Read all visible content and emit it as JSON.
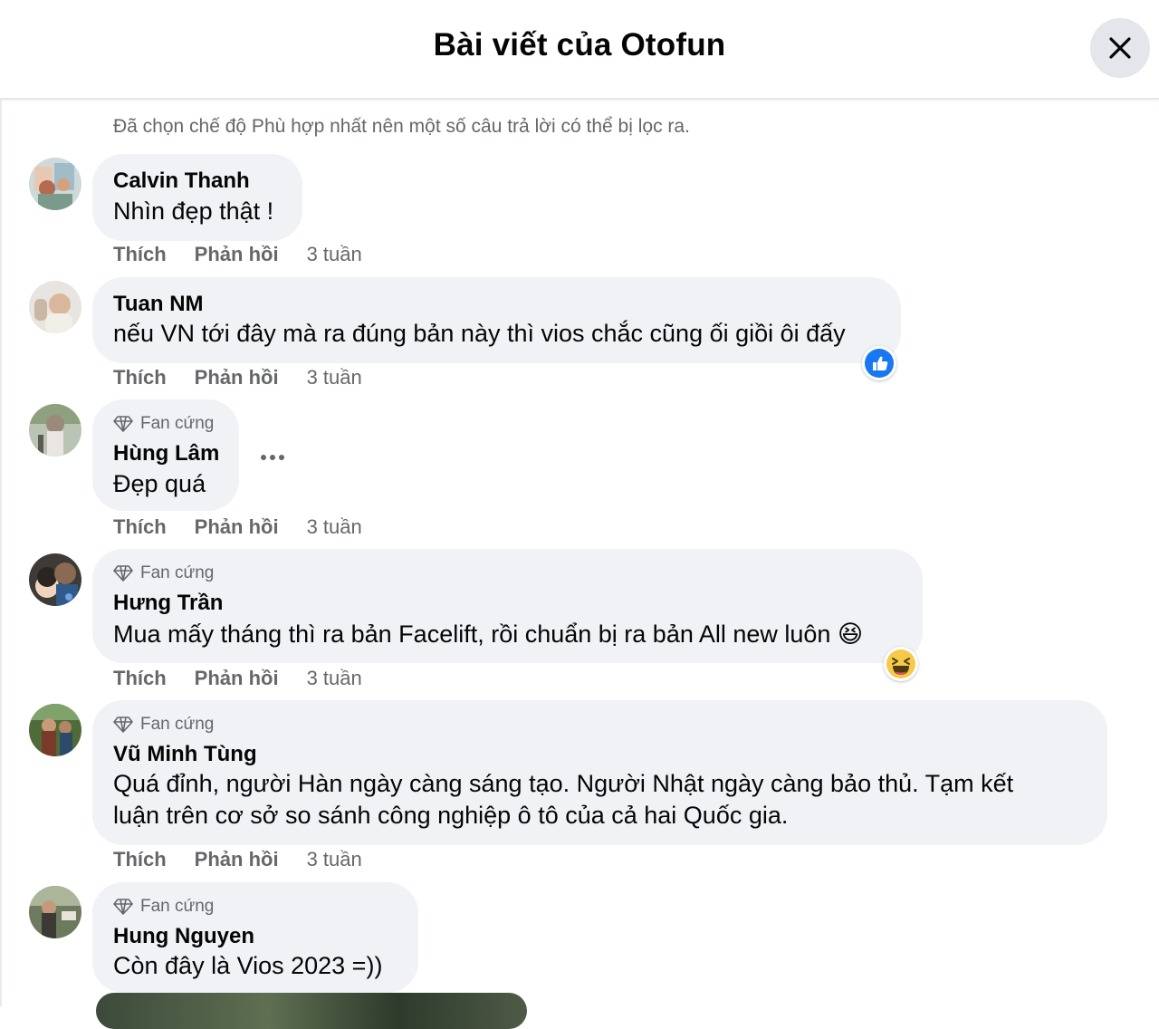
{
  "header": {
    "title": "Bài viết của Otofun",
    "close_icon": "close-icon"
  },
  "filter_note": "Đã chọn chế độ Phù hợp nhất nên một số câu trả lời có thể bị lọc ra.",
  "labels": {
    "like": "Thích",
    "reply": "Phản hồi"
  },
  "comments": [
    {
      "author": "Calvin Thanh",
      "badge": "",
      "lines": [
        "Nhìn đẹp thật !"
      ],
      "time": "3 tuần",
      "reaction": ""
    },
    {
      "author": "Tuan NM",
      "badge": "",
      "lines": [
        "nếu VN tới đây mà ra đúng bản này thì vios chắc cũng ối giồi ôi đấy"
      ],
      "time": "3 tuần",
      "reaction": "like"
    },
    {
      "author": "Hùng Lâm",
      "badge": "Fan cứng",
      "lines": [
        "Đẹp quá"
      ],
      "time": "3 tuần",
      "reaction": ""
    },
    {
      "author": "Hưng Trần",
      "badge": "Fan cứng",
      "lines": [
        "Mua mấy tháng thì ra bản Facelift, rồi chuẩn bị ra bản All new luôn 😆"
      ],
      "time": "3 tuần",
      "reaction": "haha"
    },
    {
      "author": "Vũ Minh Tùng",
      "badge": "Fan cứng",
      "lines": [
        "Quá đỉnh, người Hàn ngày càng sáng tạo. Người Nhật ngày càng bảo thủ. Tạm kết",
        "luận trên cơ sở so sánh công nghiệp ô tô của cả hai Quốc gia."
      ],
      "time": "3 tuần",
      "reaction": ""
    },
    {
      "author": "Hung Nguyen",
      "badge": "Fan cứng",
      "lines": [
        "Còn đây là Vios 2023 =))"
      ],
      "time": "",
      "reaction": ""
    }
  ],
  "colors": {
    "bubble": "#f0f2f5",
    "secondary_text": "#65676b",
    "like_blue": "#1877f2",
    "haha_yellow": "#f7c94b"
  }
}
